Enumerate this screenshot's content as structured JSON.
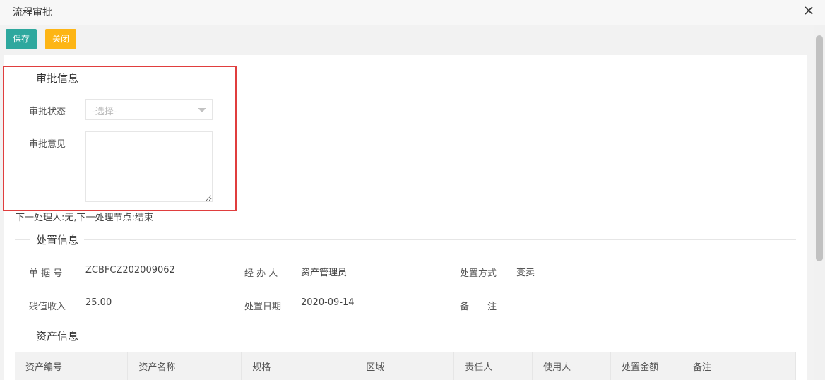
{
  "window": {
    "title": "流程审批"
  },
  "toolbar": {
    "save_label": "保存",
    "close_label": "关闭"
  },
  "approval": {
    "legend": "审批信息",
    "status_label": "审批状态",
    "status_placeholder": "-选择-",
    "opinion_label": "审批意见",
    "opinion_value": ""
  },
  "next_info": "下一处理人:无,下一处理节点:结束",
  "disposal": {
    "legend": "处置信息",
    "doc_no_label": "单 据 号",
    "doc_no_value": "ZCBFCZ202009062",
    "handler_label": "经 办 人",
    "handler_value": "资产管理员",
    "method_label": "处置方式",
    "method_value": "变卖",
    "residual_label": "残值收入",
    "residual_value": "25.00",
    "date_label": "处置日期",
    "date_value": "2020-09-14",
    "remark_label": "备　　注",
    "remark_value": ""
  },
  "assets": {
    "legend": "资产信息",
    "columns": [
      "资产编号",
      "资产名称",
      "规格",
      "区域",
      "责任人",
      "使用人",
      "处置金额",
      "备注"
    ]
  },
  "colors": {
    "save": "#2ea89e",
    "close": "#fdb515",
    "highlight": "#e03e3e"
  }
}
